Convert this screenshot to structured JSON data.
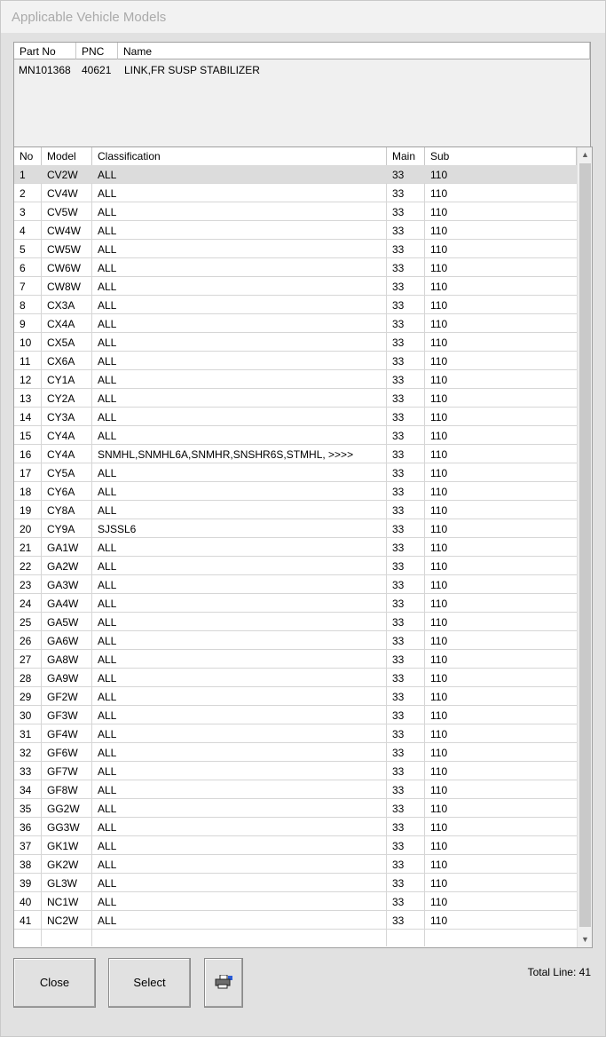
{
  "window": {
    "title": "Applicable Vehicle Models"
  },
  "part_table": {
    "headers": [
      "Part No",
      "PNC",
      "Name"
    ],
    "rows": [
      [
        "MN101368",
        "40621",
        "LINK,FR SUSP STABILIZER"
      ]
    ]
  },
  "models_table": {
    "headers": [
      "No",
      "Model",
      "Classification",
      "Main",
      "Sub"
    ],
    "rows": [
      [
        "1",
        "CV2W",
        "ALL",
        "33",
        "110"
      ],
      [
        "2",
        "CV4W",
        "ALL",
        "33",
        "110"
      ],
      [
        "3",
        "CV5W",
        "ALL",
        "33",
        "110"
      ],
      [
        "4",
        "CW4W",
        "ALL",
        "33",
        "110"
      ],
      [
        "5",
        "CW5W",
        "ALL",
        "33",
        "110"
      ],
      [
        "6",
        "CW6W",
        "ALL",
        "33",
        "110"
      ],
      [
        "7",
        "CW8W",
        "ALL",
        "33",
        "110"
      ],
      [
        "8",
        "CX3A",
        "ALL",
        "33",
        "110"
      ],
      [
        "9",
        "CX4A",
        "ALL",
        "33",
        "110"
      ],
      [
        "10",
        "CX5A",
        "ALL",
        "33",
        "110"
      ],
      [
        "11",
        "CX6A",
        "ALL",
        "33",
        "110"
      ],
      [
        "12",
        "CY1A",
        "ALL",
        "33",
        "110"
      ],
      [
        "13",
        "CY2A",
        "ALL",
        "33",
        "110"
      ],
      [
        "14",
        "CY3A",
        "ALL",
        "33",
        "110"
      ],
      [
        "15",
        "CY4A",
        "ALL",
        "33",
        "110"
      ],
      [
        "16",
        "CY4A",
        "SNMHL,SNMHL6A,SNMHR,SNSHR6S,STMHL,  >>>>",
        "33",
        "110"
      ],
      [
        "17",
        "CY5A",
        "ALL",
        "33",
        "110"
      ],
      [
        "18",
        "CY6A",
        "ALL",
        "33",
        "110"
      ],
      [
        "19",
        "CY8A",
        "ALL",
        "33",
        "110"
      ],
      [
        "20",
        "CY9A",
        "SJSSL6",
        "33",
        "110"
      ],
      [
        "21",
        "GA1W",
        "ALL",
        "33",
        "110"
      ],
      [
        "22",
        "GA2W",
        "ALL",
        "33",
        "110"
      ],
      [
        "23",
        "GA3W",
        "ALL",
        "33",
        "110"
      ],
      [
        "24",
        "GA4W",
        "ALL",
        "33",
        "110"
      ],
      [
        "25",
        "GA5W",
        "ALL",
        "33",
        "110"
      ],
      [
        "26",
        "GA6W",
        "ALL",
        "33",
        "110"
      ],
      [
        "27",
        "GA8W",
        "ALL",
        "33",
        "110"
      ],
      [
        "28",
        "GA9W",
        "ALL",
        "33",
        "110"
      ],
      [
        "29",
        "GF2W",
        "ALL",
        "33",
        "110"
      ],
      [
        "30",
        "GF3W",
        "ALL",
        "33",
        "110"
      ],
      [
        "31",
        "GF4W",
        "ALL",
        "33",
        "110"
      ],
      [
        "32",
        "GF6W",
        "ALL",
        "33",
        "110"
      ],
      [
        "33",
        "GF7W",
        "ALL",
        "33",
        "110"
      ],
      [
        "34",
        "GF8W",
        "ALL",
        "33",
        "110"
      ],
      [
        "35",
        "GG2W",
        "ALL",
        "33",
        "110"
      ],
      [
        "36",
        "GG3W",
        "ALL",
        "33",
        "110"
      ],
      [
        "37",
        "GK1W",
        "ALL",
        "33",
        "110"
      ],
      [
        "38",
        "GK2W",
        "ALL",
        "33",
        "110"
      ],
      [
        "39",
        "GL3W",
        "ALL",
        "33",
        "110"
      ],
      [
        "40",
        "NC1W",
        "ALL",
        "33",
        "110"
      ],
      [
        "41",
        "NC2W",
        "ALL",
        "33",
        "110"
      ]
    ],
    "selected_row": 0
  },
  "buttons": {
    "close": "Close",
    "select": "Select",
    "print_icon": "printer-icon"
  },
  "footer": {
    "total_line": "Total Line: 41"
  }
}
